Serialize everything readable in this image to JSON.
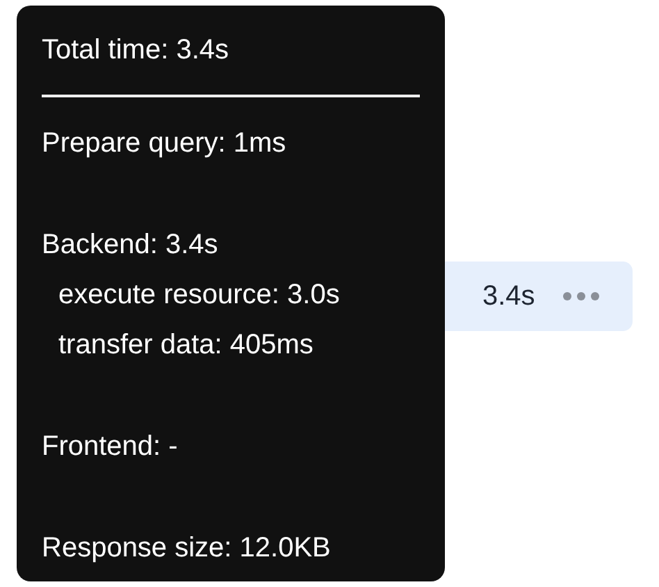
{
  "row": {
    "duration": "3.4s",
    "highlighted": true
  },
  "tooltip": {
    "title": "Total time: 3.4s",
    "groups": [
      {
        "text": "Prepare query: 1ms"
      },
      {
        "text": "Backend: 3.4s",
        "children": [
          {
            "text": "execute resource: 3.0s"
          },
          {
            "text": "transfer data: 405ms"
          }
        ]
      },
      {
        "text": "Frontend: -"
      },
      {
        "text": "Response size: 12.0KB"
      }
    ]
  }
}
